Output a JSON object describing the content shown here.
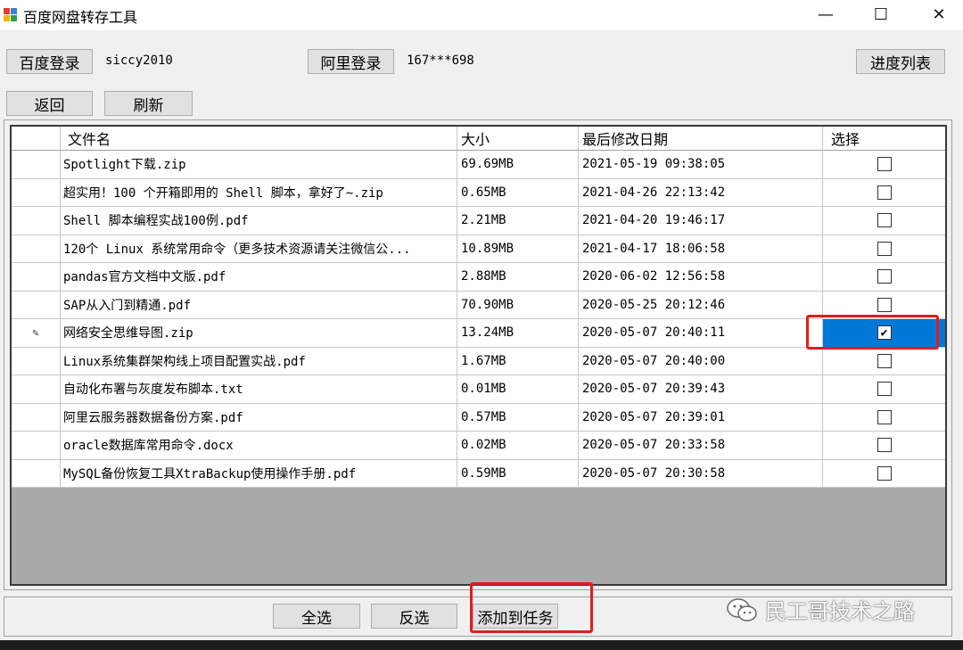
{
  "window": {
    "title": "百度网盘转存工具",
    "minimize": "—",
    "maximize": "☐",
    "close": "✕"
  },
  "accounts": {
    "baidu_login_label": "百度登录",
    "baidu_user": "siccy2010",
    "ali_login_label": "阿里登录",
    "ali_user": "167***698",
    "progress_list_label": "进度列表"
  },
  "nav": {
    "back_label": "返回",
    "refresh_label": "刷新"
  },
  "table": {
    "columns": [
      "文件名",
      "大小",
      "最后修改日期",
      "选择"
    ],
    "rows": [
      {
        "name": "Spotlight下载.zip",
        "size": "69.69MB",
        "date": "2021-05-19 09:38:05",
        "checked": false
      },
      {
        "name": "超实用！100 个开箱即用的 Shell 脚本，拿好了~.zip",
        "size": "0.65MB",
        "date": "2021-04-26 22:13:42",
        "checked": false
      },
      {
        "name": "Shell 脚本编程实战100例.pdf",
        "size": "2.21MB",
        "date": "2021-04-20 19:46:17",
        "checked": false
      },
      {
        "name": "120个 Linux 系统常用命令（更多技术资源请关注微信公...",
        "size": "10.89MB",
        "date": "2021-04-17 18:06:58",
        "checked": false
      },
      {
        "name": "pandas官方文档中文版.pdf",
        "size": "2.88MB",
        "date": "2020-06-02 12:56:58",
        "checked": false
      },
      {
        "name": "SAP从入门到精通.pdf",
        "size": "70.90MB",
        "date": "2020-05-25 20:12:46",
        "checked": false
      },
      {
        "name": "网络安全思维导图.zip",
        "size": "13.24MB",
        "date": "2020-05-07 20:40:11",
        "checked": true
      },
      {
        "name": "Linux系统集群架构线上项目配置实战.pdf",
        "size": "1.67MB",
        "date": "2020-05-07 20:40:00",
        "checked": false
      },
      {
        "name": "自动化布署与灰度发布脚本.txt",
        "size": "0.01MB",
        "date": "2020-05-07 20:39:43",
        "checked": false
      },
      {
        "name": "阿里云服务器数据备份方案.pdf",
        "size": "0.57MB",
        "date": "2020-05-07 20:39:01",
        "checked": false
      },
      {
        "name": "oracle数据库常用命令.docx",
        "size": "0.02MB",
        "date": "2020-05-07 20:33:58",
        "checked": false
      },
      {
        "name": "MySQL备份恢复工具XtraBackup使用操作手册.pdf",
        "size": "0.59MB",
        "date": "2020-05-07 20:30:58",
        "checked": false
      }
    ],
    "checkmark": "✔",
    "edit_marker": "✎"
  },
  "actions": {
    "select_all_label": "全选",
    "invert_label": "反选",
    "add_task_label": "添加到任务"
  },
  "watermark": "民工哥技术之路",
  "colors": {
    "selection": "#0078d7",
    "highlight_box": "#e41c1c"
  }
}
